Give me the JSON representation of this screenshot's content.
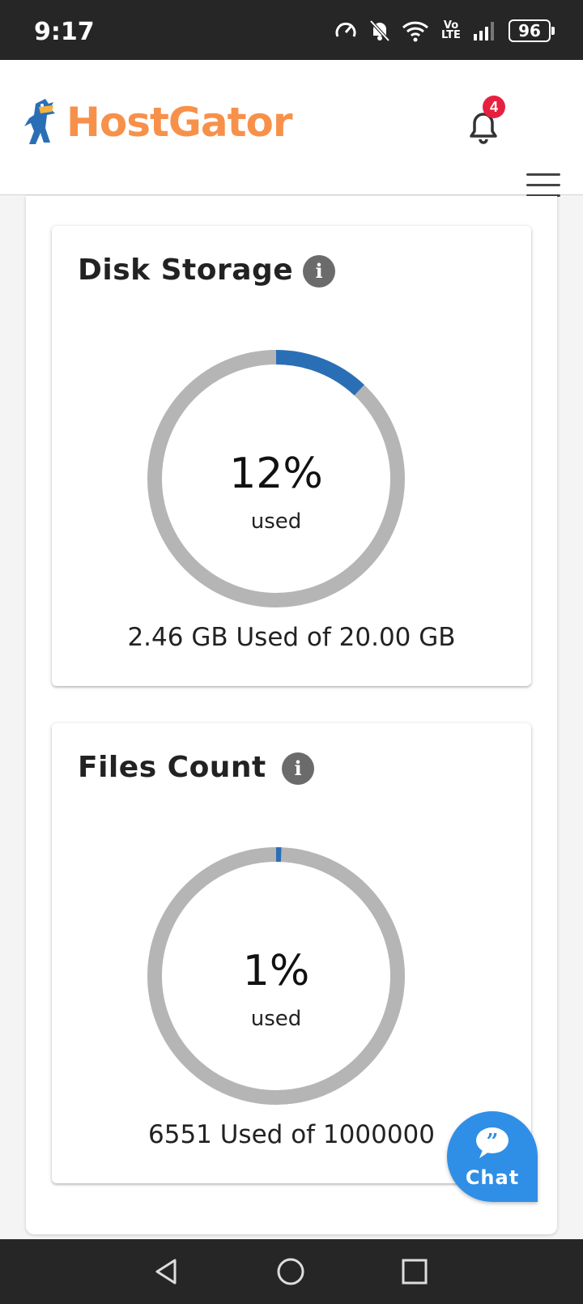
{
  "status_bar": {
    "time": "9:17",
    "battery": "96",
    "network_label": "Vo LTE",
    "icons": [
      "data-saver-icon",
      "mute-icon",
      "wifi-icon",
      "volte-icon",
      "signal-icon",
      "battery-icon"
    ]
  },
  "header": {
    "logo_text": "HostGator",
    "notification_count": "4",
    "accent": "#f7914a",
    "badge_color": "#e8203f"
  },
  "cards": [
    {
      "title": "Disk Storage",
      "percent_label": "12%",
      "used_label": "used",
      "caption": "2.46 GB Used of 20.00 GB",
      "fraction": 0.12
    },
    {
      "title": "Files Count",
      "percent_label": "1%",
      "used_label": "used",
      "caption": "6551 Used of 1000000",
      "fraction": 0.0066
    }
  ],
  "gauge_colors": {
    "track": "#b5b5b5",
    "fill": "#2a6fb6"
  },
  "chat": {
    "label": "Chat",
    "color": "#2f8fe6"
  },
  "nav": {
    "icons": [
      "back-icon",
      "home-icon",
      "recents-icon"
    ]
  }
}
